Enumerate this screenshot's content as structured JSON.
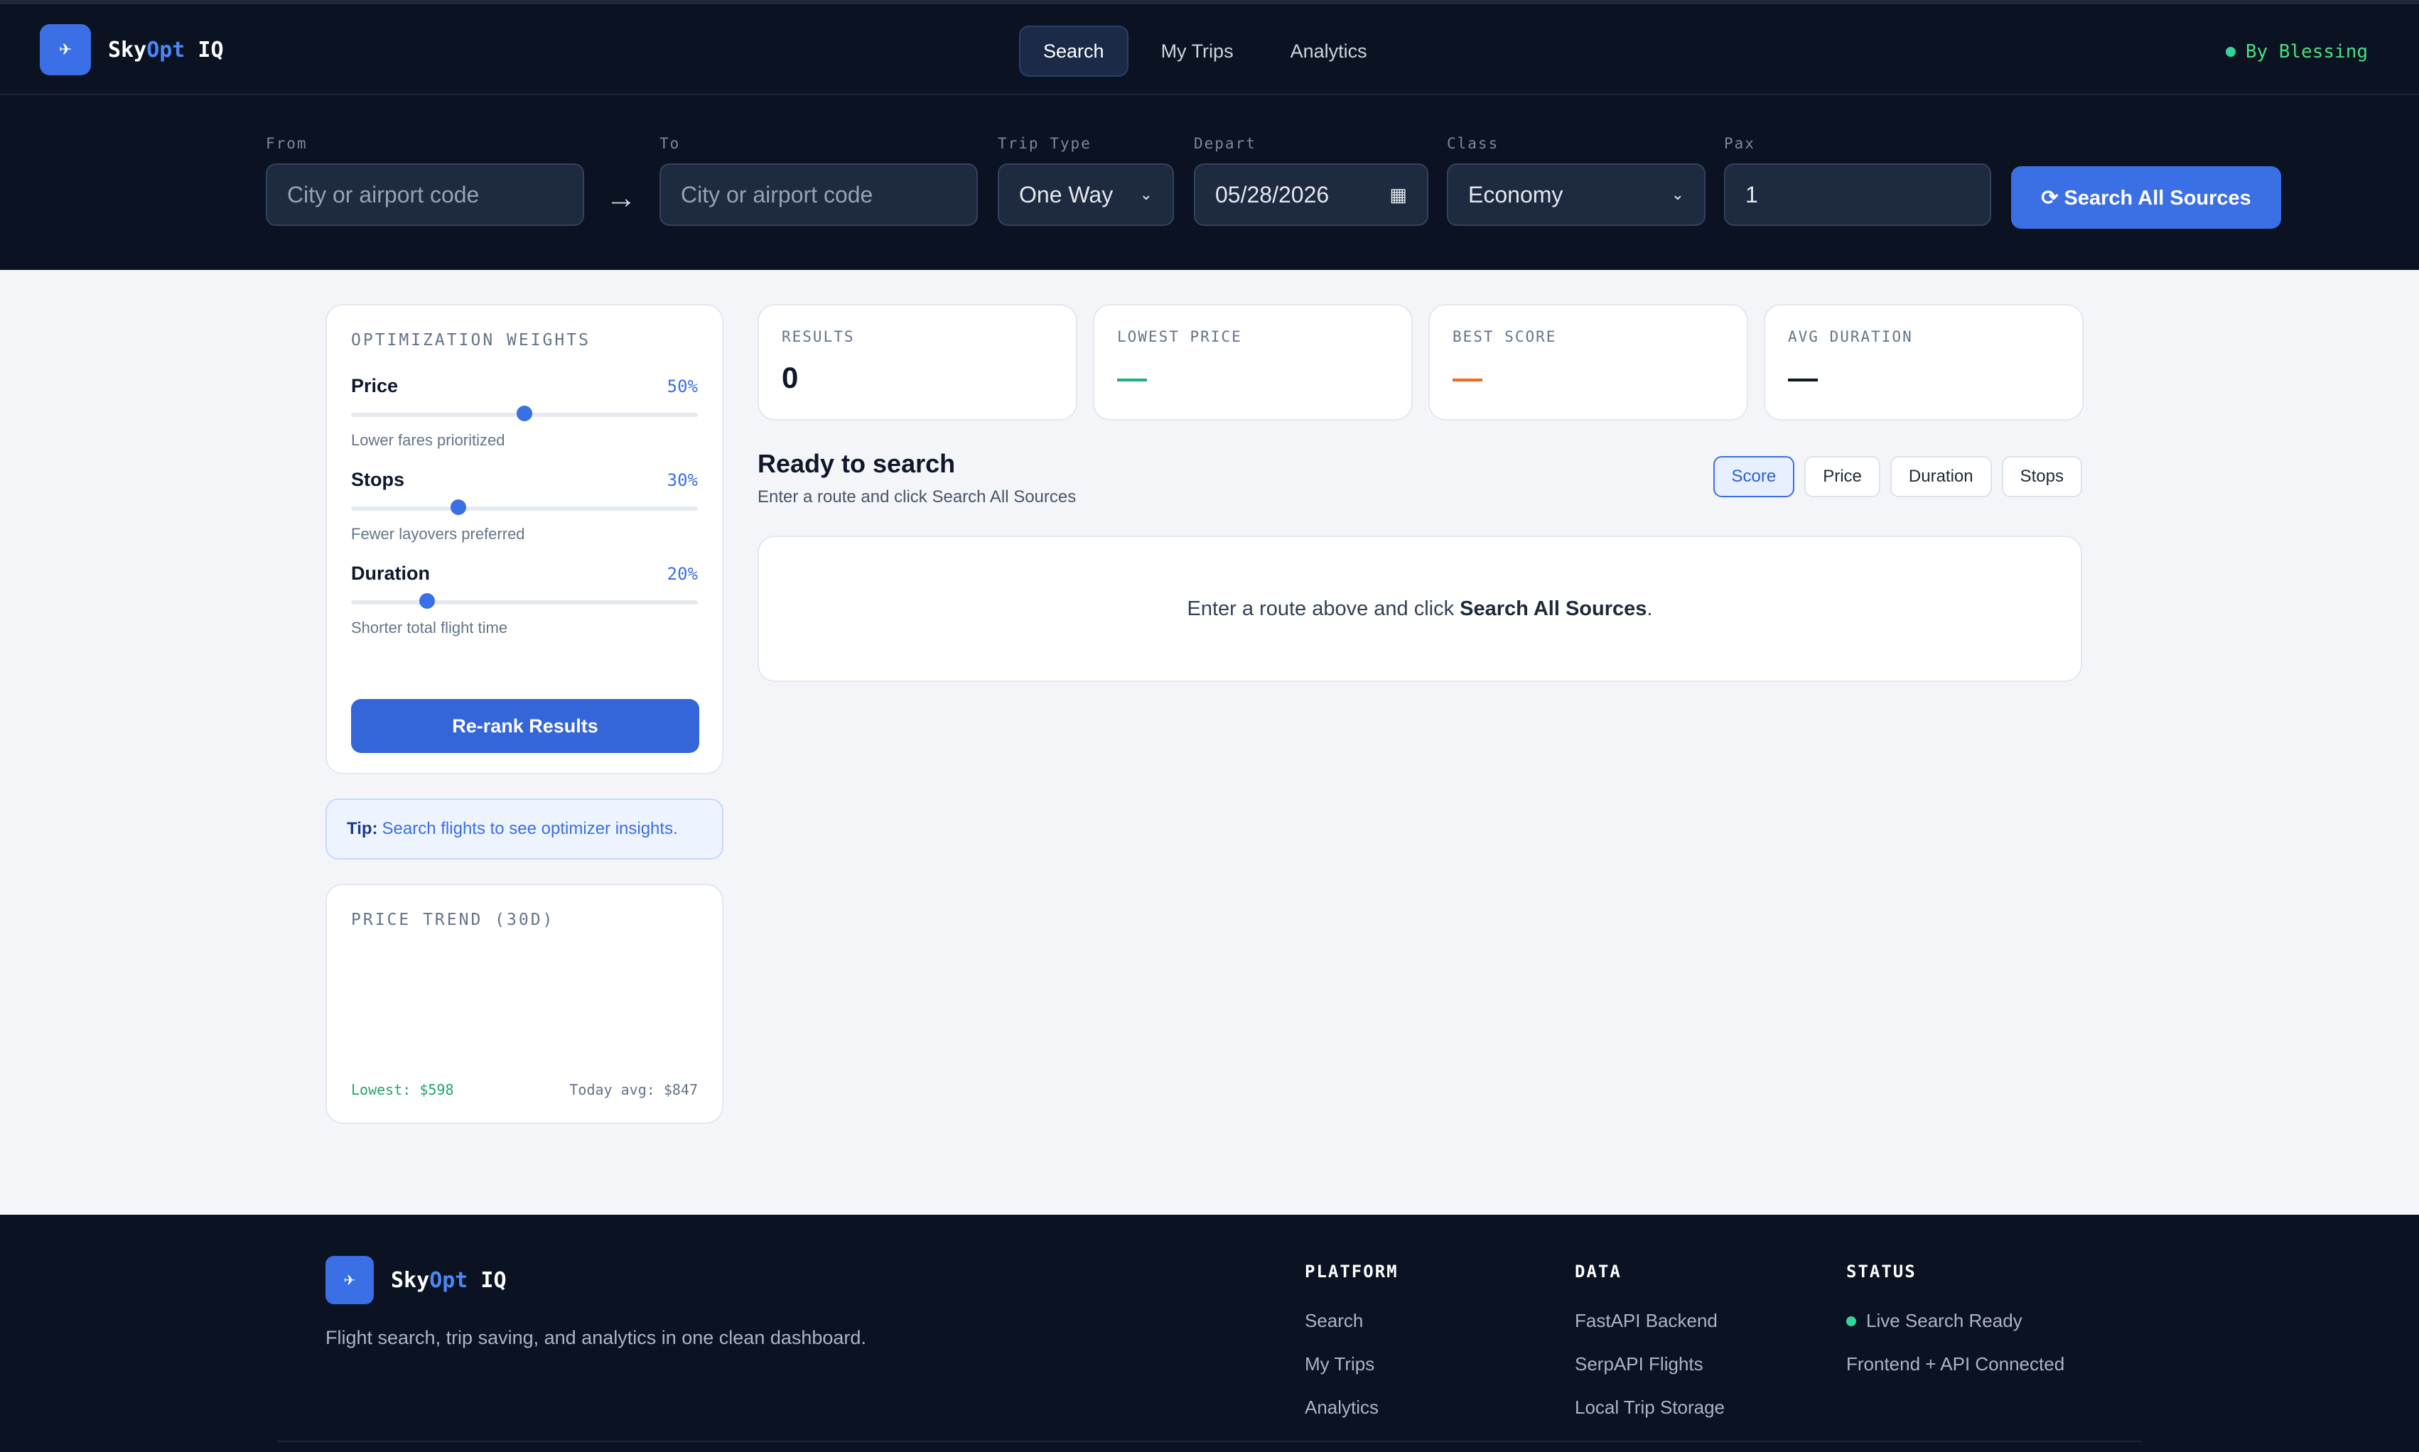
{
  "brand": {
    "name_a": "Sky",
    "name_b": "Opt",
    "name_c": " IQ",
    "logo_icon": "plane-icon"
  },
  "nav": {
    "tabs": [
      {
        "label": "Search",
        "active": true
      },
      {
        "label": "My Trips"
      },
      {
        "label": "Analytics"
      }
    ]
  },
  "status": {
    "text": "By Blessing"
  },
  "search": {
    "from_label": "From",
    "from_placeholder": "City or airport code",
    "to_label": "To",
    "to_placeholder": "City or airport code",
    "trip_label": "Trip Type",
    "trip_value": "One Way",
    "depart_label": "Depart",
    "depart_value": "05/28/2026",
    "class_label": "Class",
    "class_value": "Economy",
    "pax_label": "Pax",
    "pax_value": "1",
    "button": "⟳ Search All Sources",
    "arrow": "→"
  },
  "weights": {
    "title": "OPTIMIZATION WEIGHTS",
    "items": [
      {
        "name": "Price",
        "pct": "50%",
        "value": 0.5,
        "hint": "Lower fares prioritized"
      },
      {
        "name": "Stops",
        "pct": "30%",
        "value": 0.31,
        "hint": "Fewer layovers preferred"
      },
      {
        "name": "Duration",
        "pct": "20%",
        "value": 0.22,
        "hint": "Shorter total flight time"
      }
    ],
    "button": "Re-rank Results"
  },
  "tip": {
    "label": "Tip:",
    "text": "Search flights to see optimizer insights."
  },
  "trend": {
    "title": "PRICE TREND (30D)",
    "lowest": "Lowest: $598",
    "avg": "Today avg: $847"
  },
  "stats": [
    {
      "label": "RESULTS",
      "value": "0"
    },
    {
      "label": "LOWEST PRICE",
      "value": "—"
    },
    {
      "label": "BEST SCORE",
      "value": "—"
    },
    {
      "label": "AVG DURATION",
      "value": "—"
    }
  ],
  "results": {
    "title": "Ready to search",
    "subtitle": "Enter a route and click Search All Sources",
    "sort": [
      {
        "label": "Score",
        "active": true
      },
      {
        "label": "Price"
      },
      {
        "label": "Duration"
      },
      {
        "label": "Stops"
      }
    ],
    "empty_pre": "Enter a route above and click",
    "empty_bold": "Search All Sources",
    "empty_post": "."
  },
  "footer": {
    "tagline": "Flight search, trip saving, and analytics in one clean dashboard.",
    "platform": {
      "title": "PLATFORM",
      "links": [
        "Search",
        "My Trips",
        "Analytics"
      ]
    },
    "data": {
      "title": "DATA",
      "links": [
        "FastAPI Backend",
        "SerpAPI Flights",
        "Local Trip Storage"
      ]
    },
    "status": {
      "title": "STATUS",
      "links": [
        "Live Search Ready",
        "Frontend + API Connected"
      ]
    }
  },
  "colors": {
    "accent": "#3b6fe6",
    "bg_dark": "#0b1323",
    "positive": "#22b07a",
    "warning": "#f06b1e"
  }
}
